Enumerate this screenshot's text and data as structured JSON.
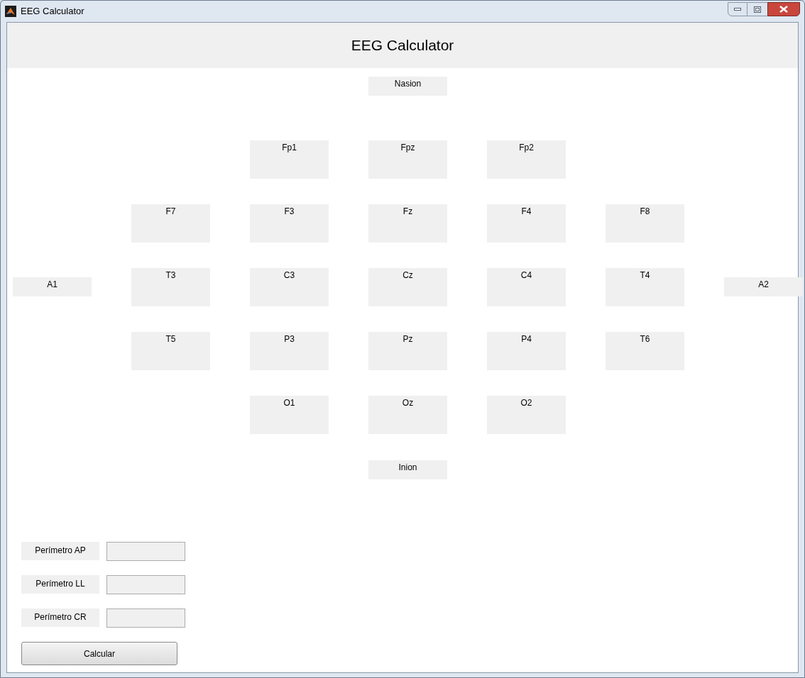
{
  "window": {
    "title": "EEG Calculator"
  },
  "header": {
    "title": "EEG Calculator"
  },
  "landmarks": {
    "top": "Nasion",
    "left": "A1",
    "right": "A2",
    "bottom": "Inion"
  },
  "electrode_rows": [
    [
      "Fp1",
      "Fpz",
      "Fp2"
    ],
    [
      "F7",
      "F3",
      "Fz",
      "F4",
      "F8"
    ],
    [
      "T3",
      "C3",
      "Cz",
      "C4",
      "T4"
    ],
    [
      "T5",
      "P3",
      "Pz",
      "P4",
      "T6"
    ],
    [
      "O1",
      "Oz",
      "O2"
    ]
  ],
  "inputs": [
    {
      "label": "Perímetro AP"
    },
    {
      "label": "Perímetro LL"
    },
    {
      "label": "Perímetro CR"
    }
  ],
  "button": "Calcular"
}
